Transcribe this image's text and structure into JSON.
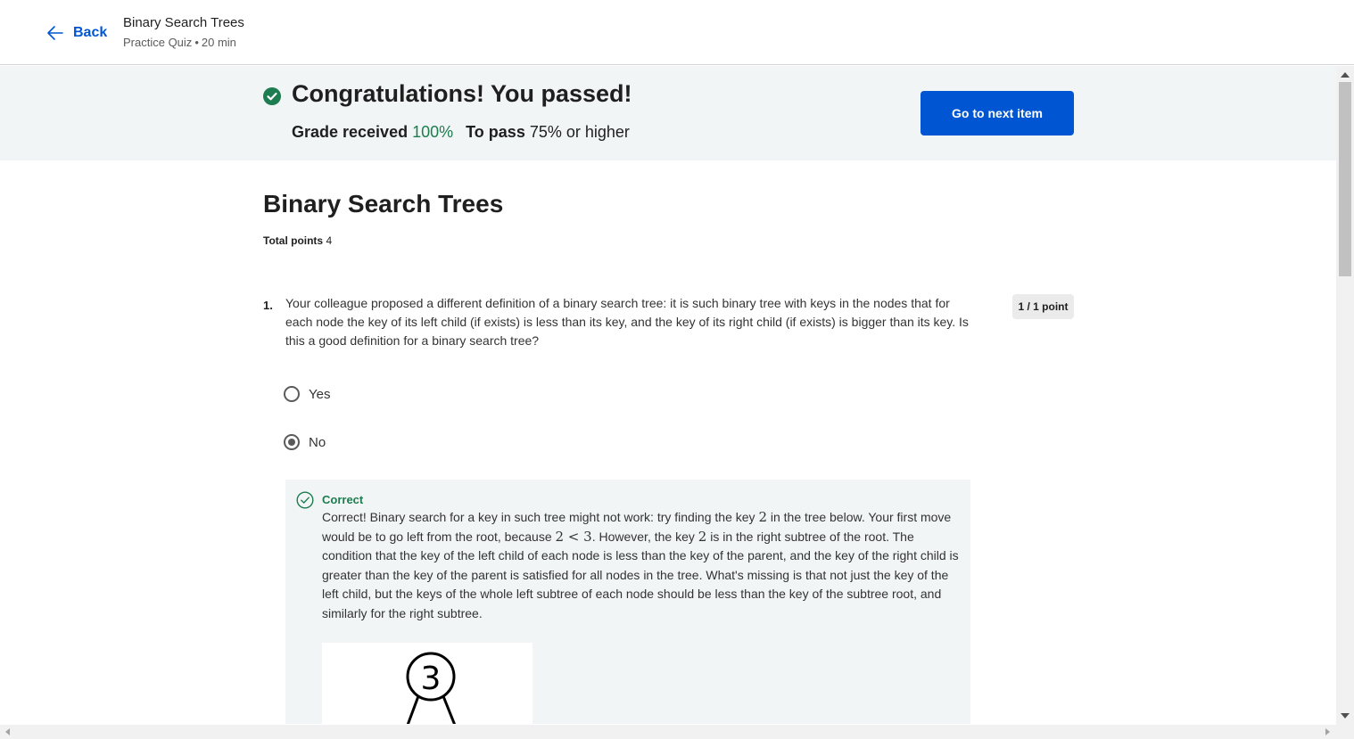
{
  "header": {
    "back_label": "Back",
    "title": "Binary Search Trees",
    "subtitle_type": "Practice Quiz",
    "subtitle_separator": "•",
    "subtitle_duration": "20 min"
  },
  "banner": {
    "title": "Congratulations! You passed!",
    "grade_label": "Grade received",
    "grade_value": "100%",
    "pass_label": "To pass",
    "pass_value": "75% or higher",
    "next_button_label": "Go to next item",
    "accent_color": "#1d7c50",
    "button_color": "#0056d2"
  },
  "quiz": {
    "title": "Binary Search Trees",
    "total_points_label": "Total points",
    "total_points_value": "4"
  },
  "questions": [
    {
      "number": "1.",
      "text": "Your colleague proposed a different definition of a binary search tree: it is such binary tree with keys in the nodes that for each node the key of its left child (if exists) is less than its key, and the key of its right child (if exists) is bigger than its key. Is this a good definition for a binary search tree?",
      "points": "1 / 1 point",
      "options": [
        {
          "label": "Yes",
          "selected": false
        },
        {
          "label": "No",
          "selected": true
        }
      ],
      "feedback": {
        "status": "Correct",
        "text_parts": [
          "Correct! Binary search for a key in such tree might not work: try finding the key ",
          "2",
          " in the tree below. Your first move would be to go left from the root, because ",
          "2 < 3",
          ". However, the key ",
          "2",
          " is in the right subtree of the root. The condition that the key of the left child of each node is less than the key of the parent, and the key of the right child is greater than the key of the parent is satisfied for all nodes in the tree. What's missing is that not just the key of the left child, but the keys of the whole left subtree of each node should be less than the key of the subtree root, and similarly for the right subtree."
        ],
        "tree_root_key": "3"
      }
    }
  ]
}
